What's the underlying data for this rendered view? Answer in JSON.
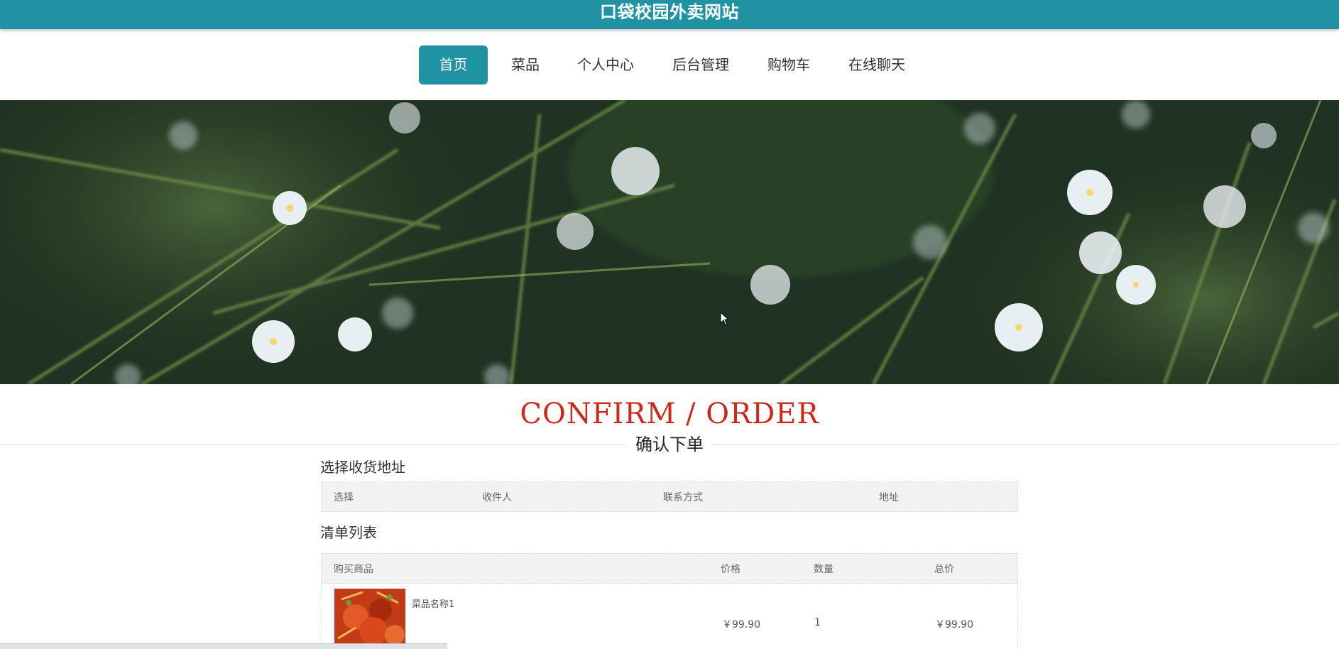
{
  "header": {
    "site_title": "口袋校园外卖网站"
  },
  "nav": {
    "items": [
      {
        "label": "首页",
        "active": true
      },
      {
        "label": "菜品",
        "active": false
      },
      {
        "label": "个人中心",
        "active": false
      },
      {
        "label": "后台管理",
        "active": false
      },
      {
        "label": "购物车",
        "active": false
      },
      {
        "label": "在线聊天",
        "active": false
      }
    ]
  },
  "section": {
    "title_en": "CONFIRM / ORDER",
    "title_cn": "确认下单"
  },
  "address": {
    "title": "选择收货地址",
    "columns": [
      "选择",
      "收件人",
      "联系方式",
      "地址"
    ]
  },
  "order_list": {
    "title": "清单列表",
    "columns": [
      "购买商品",
      "价格",
      "数量",
      "总价"
    ],
    "rows": [
      {
        "name": "菜品名称1",
        "price": "￥99.90",
        "quantity": "1",
        "total": "￥99.90"
      }
    ]
  },
  "colors": {
    "primary": "#1f92a3",
    "heading_red": "#d0271a"
  }
}
